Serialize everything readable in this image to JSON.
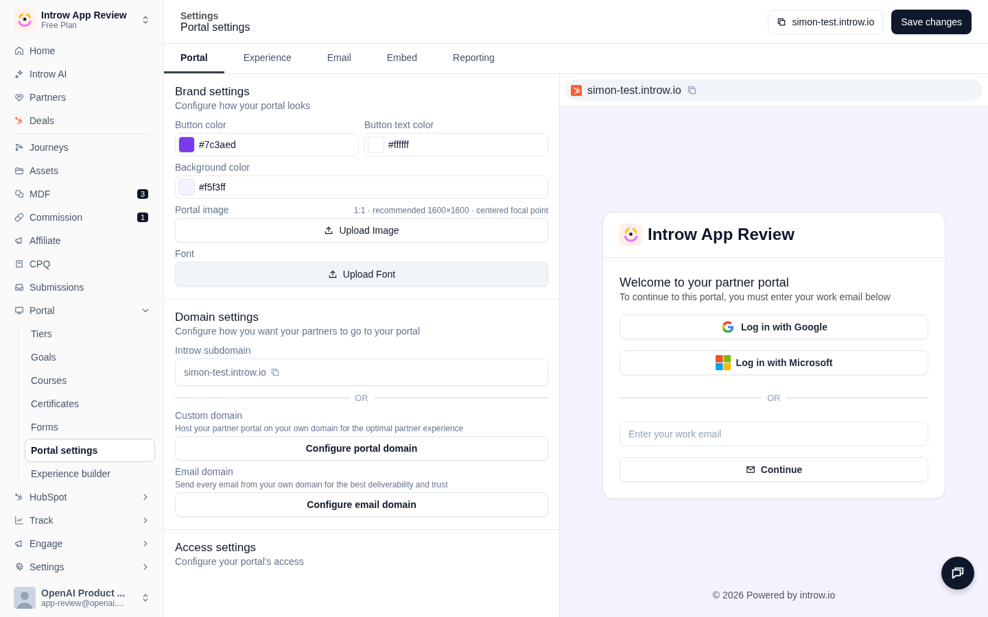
{
  "sidebar": {
    "workspace": {
      "name": "Introw App Review",
      "plan": "Free Plan"
    },
    "nav_primary": [
      {
        "label": "Home",
        "selected": false
      },
      {
        "label": "Introw AI",
        "selected": false
      },
      {
        "label": "Partners",
        "selected": false
      },
      {
        "label": "Deals",
        "selected": false
      }
    ],
    "nav_secondary": [
      {
        "label": "Journeys",
        "selected": false
      },
      {
        "label": "Assets",
        "selected": false
      },
      {
        "label": "MDF",
        "selected": false,
        "badge": "3"
      },
      {
        "label": "Commission",
        "selected": false,
        "badge": "1"
      },
      {
        "label": "Affiliate",
        "selected": false
      },
      {
        "label": "CPQ",
        "selected": false
      },
      {
        "label": "Submissions",
        "selected": false
      },
      {
        "label": "Portal",
        "selected": false,
        "expanded": true,
        "children": [
          {
            "label": "Tiers",
            "selected": false
          },
          {
            "label": "Goals",
            "selected": false
          },
          {
            "label": "Courses",
            "selected": false
          },
          {
            "label": "Certificates",
            "selected": false
          },
          {
            "label": "Forms",
            "selected": false
          },
          {
            "label": "Portal settings",
            "selected": true
          },
          {
            "label": "Experience builder",
            "selected": false
          }
        ]
      },
      {
        "label": "HubSpot",
        "selected": false,
        "expanded": false
      },
      {
        "label": "Track",
        "selected": false,
        "expanded": false
      },
      {
        "label": "Engage",
        "selected": false,
        "expanded": false
      },
      {
        "label": "Settings",
        "selected": false,
        "expanded": false
      }
    ],
    "user": {
      "name": "OpenAI Product ...",
      "email": "app-review@openai...."
    }
  },
  "header": {
    "breadcrumb": "Settings",
    "title": "Portal settings",
    "domain_button": "simon-test.introw.io",
    "save_button": "Save changes"
  },
  "tabs": [
    {
      "label": "Portal",
      "selected": true
    },
    {
      "label": "Experience",
      "selected": false
    },
    {
      "label": "Email",
      "selected": false
    },
    {
      "label": "Embed",
      "selected": false
    },
    {
      "label": "Reporting",
      "selected": false
    }
  ],
  "brand_settings": {
    "title": "Brand settings",
    "subtitle": "Configure how your portal looks",
    "button_color": {
      "label": "Button color",
      "value": "#7c3aed"
    },
    "button_text_color": {
      "label": "Button text color",
      "value": "#ffffff"
    },
    "background_color": {
      "label": "Background color",
      "value": "#f5f3ff"
    },
    "portal_image": {
      "label": "Portal image",
      "hint": "1:1 · recommended 1600×1600 · centered focal point",
      "button": "Upload Image",
      "hovered": false
    },
    "font": {
      "label": "Font",
      "button": "Upload Font",
      "hovered": true
    }
  },
  "domain_settings": {
    "title": "Domain settings",
    "subtitle": "Configure how you want your partners to go to your portal",
    "subdomain": {
      "label": "Introw subdomain",
      "value": "simon-test.introw.io"
    },
    "separator": "OR",
    "custom_domain": {
      "label": "Custom domain",
      "description": "Host your partner portal on your own domain for the optimal partner experience",
      "button": "Configure portal domain"
    },
    "email_domain": {
      "label": "Email domain",
      "description": "Send every email from your own domain for the best deliverability and trust",
      "button": "Configure email domain"
    }
  },
  "access_settings": {
    "title": "Access settings",
    "subtitle": "Configure your portal's access"
  },
  "preview": {
    "url": "simon-test.introw.io",
    "card": {
      "brand": "Introw App Review",
      "title": "Welcome to your partner portal",
      "subtitle": "To continue to this portal, you must enter your work email below",
      "google_button": "Log in with Google",
      "microsoft_button": "Log in with Microsoft",
      "separator": "OR",
      "email_placeholder": "Enter your work email",
      "continue_button": "Continue"
    },
    "footer": "© 2026 Powered by introw.io"
  }
}
